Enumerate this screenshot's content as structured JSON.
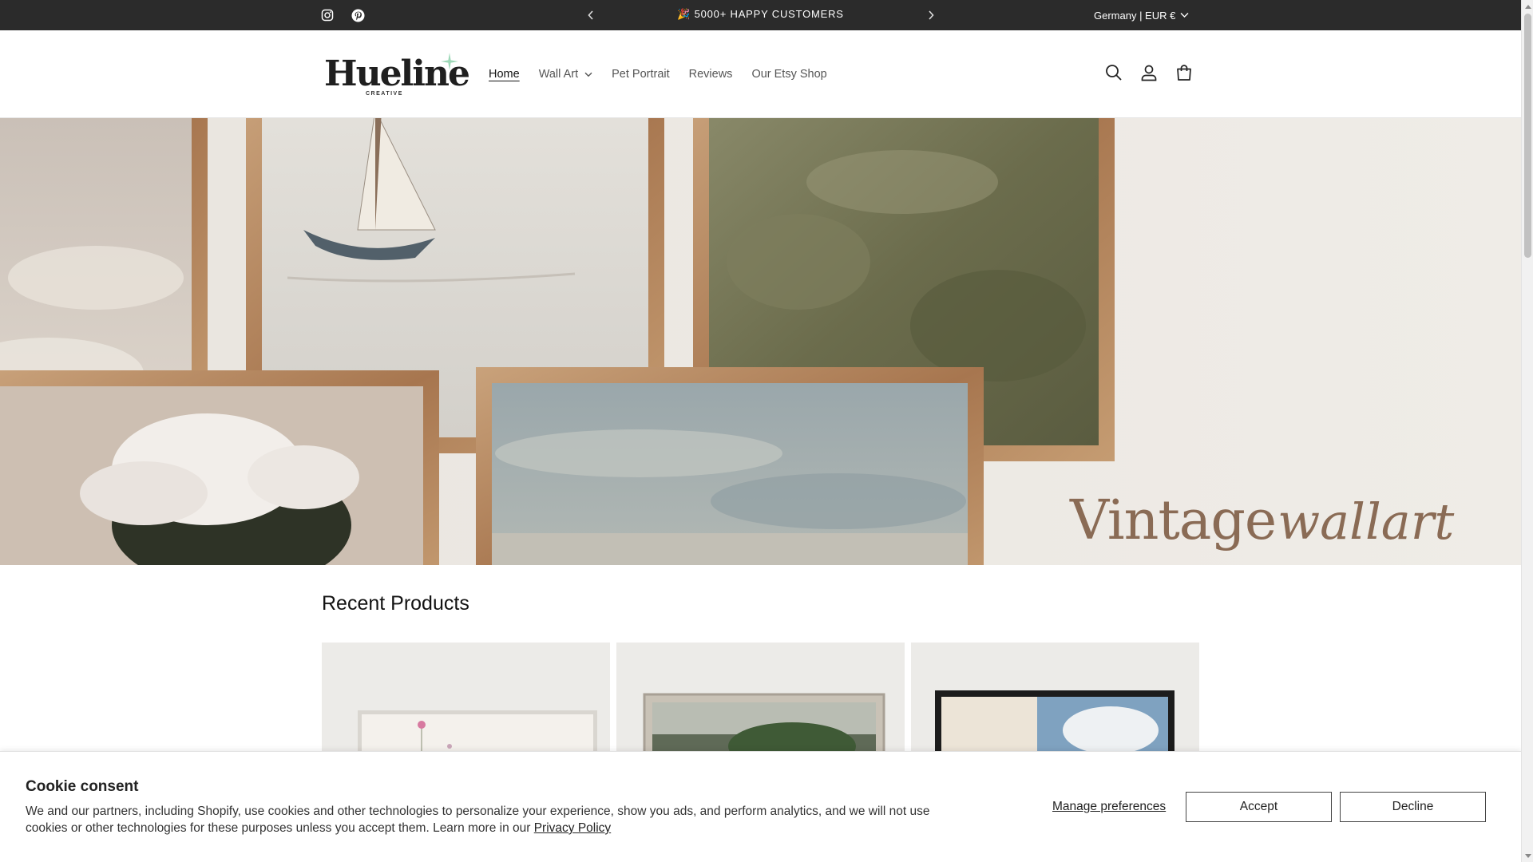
{
  "announcement": {
    "message": "🎉 5000+ HAPPY CUSTOMERS",
    "country": "Germany | EUR €",
    "social_icons": [
      "instagram-icon",
      "pinterest-icon"
    ]
  },
  "header": {
    "logo_text": "Hueline",
    "logo_subtext": "CREATIVE",
    "nav": [
      {
        "label": "Home"
      },
      {
        "label": "Wall Art"
      },
      {
        "label": "Pet Portrait"
      },
      {
        "label": "Reviews"
      },
      {
        "label": "Our Etsy Shop"
      }
    ],
    "icons": [
      "search-icon",
      "account-icon",
      "cart-icon"
    ]
  },
  "hero": {
    "caption_main": "Vintage",
    "caption_script": "wallart"
  },
  "recent_products": {
    "title": "Recent Products"
  },
  "cookie": {
    "title": "Cookie consent",
    "text": "We and our partners, including Shopify, use cookies and other technologies to personalize your experience, show you ads, and perform analytics, and we will not use cookies or other technologies for these purposes unless you accept them. Learn more in our ",
    "link": "Privacy Policy",
    "manage": "Manage preferences",
    "accept": "Accept",
    "decline": "Decline"
  },
  "colors": {
    "announcement_bg": "#2b2b2b",
    "frame_gold": "#b88d63",
    "caption_brown": "#8a6b55"
  }
}
